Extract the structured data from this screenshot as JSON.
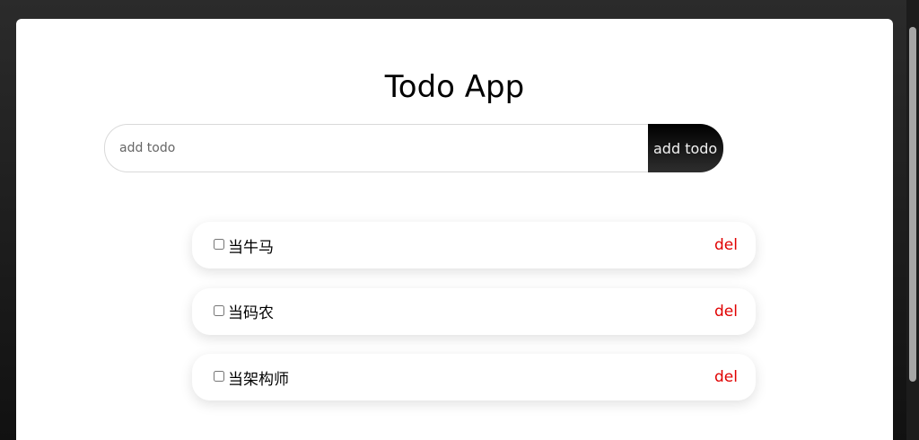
{
  "app": {
    "title": "Todo App"
  },
  "add": {
    "placeholder": "add todo",
    "value": "",
    "button_label": "add todo"
  },
  "todos": [
    {
      "text": "当牛马",
      "checked": false,
      "delete_label": "del"
    },
    {
      "text": "当码农",
      "checked": false,
      "delete_label": "del"
    },
    {
      "text": "当架构师",
      "checked": false,
      "delete_label": "del"
    }
  ],
  "colors": {
    "background": "#1f1f1f",
    "surface": "#ffffff",
    "button": "#000000",
    "delete": "#e00000"
  }
}
